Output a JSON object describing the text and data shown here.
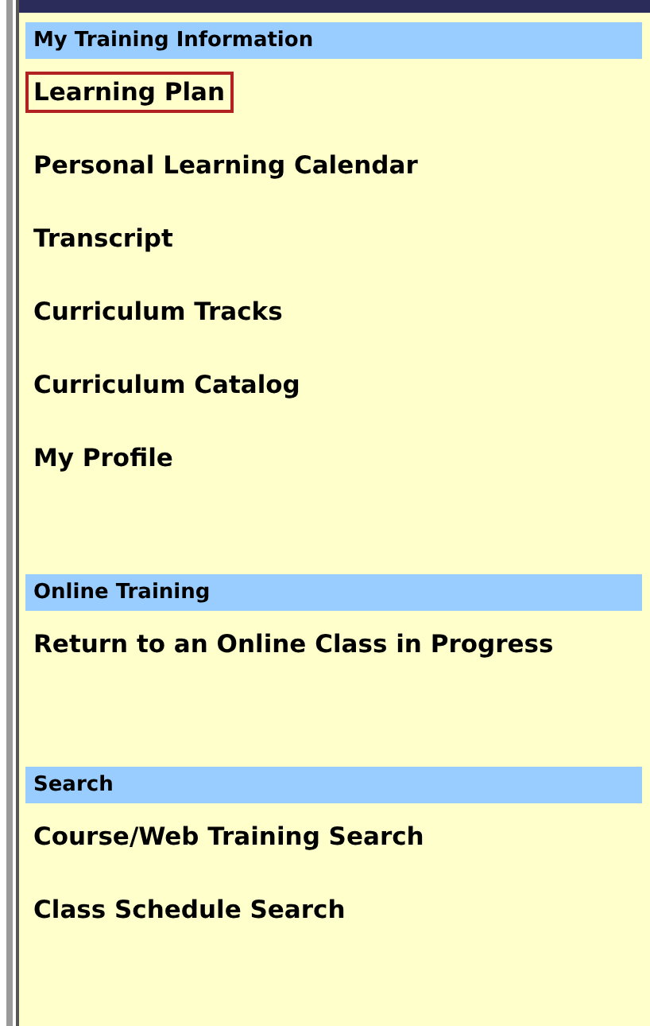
{
  "sections": [
    {
      "title": "My Training Information",
      "items": [
        {
          "label": "Learning Plan",
          "selected": true
        },
        {
          "label": "Personal Learning Calendar",
          "selected": false
        },
        {
          "label": "Transcript",
          "selected": false
        },
        {
          "label": "Curriculum Tracks",
          "selected": false
        },
        {
          "label": "Curriculum Catalog",
          "selected": false
        },
        {
          "label": "My Profile",
          "selected": false
        }
      ]
    },
    {
      "title": "Online Training",
      "items": [
        {
          "label": "Return to an Online Class in Progress",
          "selected": false
        }
      ]
    },
    {
      "title": "Search",
      "items": [
        {
          "label": "Course/Web Training Search",
          "selected": false
        },
        {
          "label": "Class Schedule Search",
          "selected": false
        }
      ]
    }
  ]
}
